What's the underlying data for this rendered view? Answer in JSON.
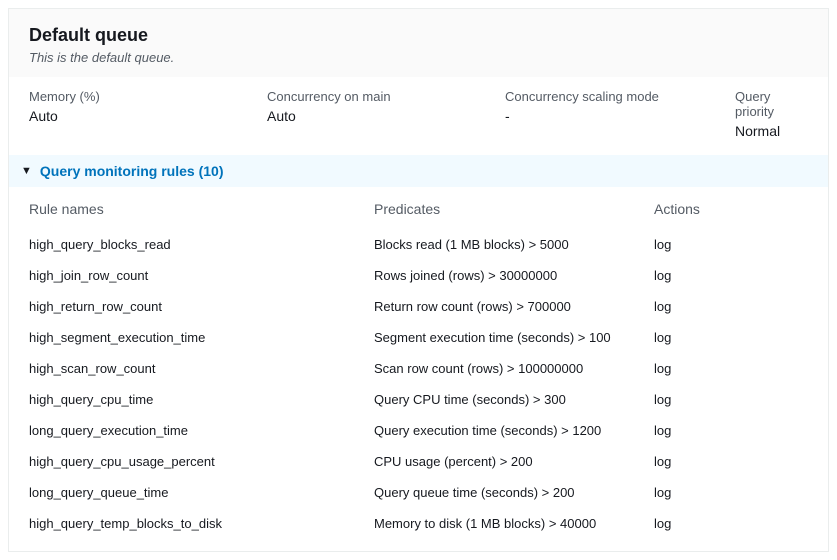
{
  "header": {
    "title": "Default queue",
    "subtitle": "This is the default queue."
  },
  "properties": {
    "memory_label": "Memory (%)",
    "memory_value": "Auto",
    "concurrency_main_label": "Concurrency on main",
    "concurrency_main_value": "Auto",
    "concurrency_scaling_label": "Concurrency scaling mode",
    "concurrency_scaling_value": "-",
    "query_priority_label": "Query priority",
    "query_priority_value": "Normal"
  },
  "expand": {
    "label": "Query monitoring rules (10)"
  },
  "rules": {
    "headers": {
      "name": "Rule names",
      "predicate": "Predicates",
      "action": "Actions"
    },
    "rows": [
      {
        "name": "high_query_blocks_read",
        "predicate": "Blocks read (1 MB blocks) > 5000",
        "action": "log"
      },
      {
        "name": "high_join_row_count",
        "predicate": "Rows joined (rows) > 30000000",
        "action": "log"
      },
      {
        "name": "high_return_row_count",
        "predicate": "Return row count (rows) > 700000",
        "action": "log"
      },
      {
        "name": "high_segment_execution_time",
        "predicate": "Segment execution time (seconds) > 100",
        "action": "log"
      },
      {
        "name": "high_scan_row_count",
        "predicate": "Scan row count (rows) > 100000000",
        "action": "log"
      },
      {
        "name": "high_query_cpu_time",
        "predicate": "Query CPU time (seconds) > 300",
        "action": "log"
      },
      {
        "name": "long_query_execution_time",
        "predicate": "Query execution time (seconds) > 1200",
        "action": "log"
      },
      {
        "name": "high_query_cpu_usage_percent",
        "predicate": "CPU usage (percent) > 200",
        "action": "log"
      },
      {
        "name": "long_query_queue_time",
        "predicate": "Query queue time (seconds) > 200",
        "action": "log"
      },
      {
        "name": "high_query_temp_blocks_to_disk",
        "predicate": "Memory to disk (1 MB blocks) > 40000",
        "action": "log"
      }
    ]
  }
}
